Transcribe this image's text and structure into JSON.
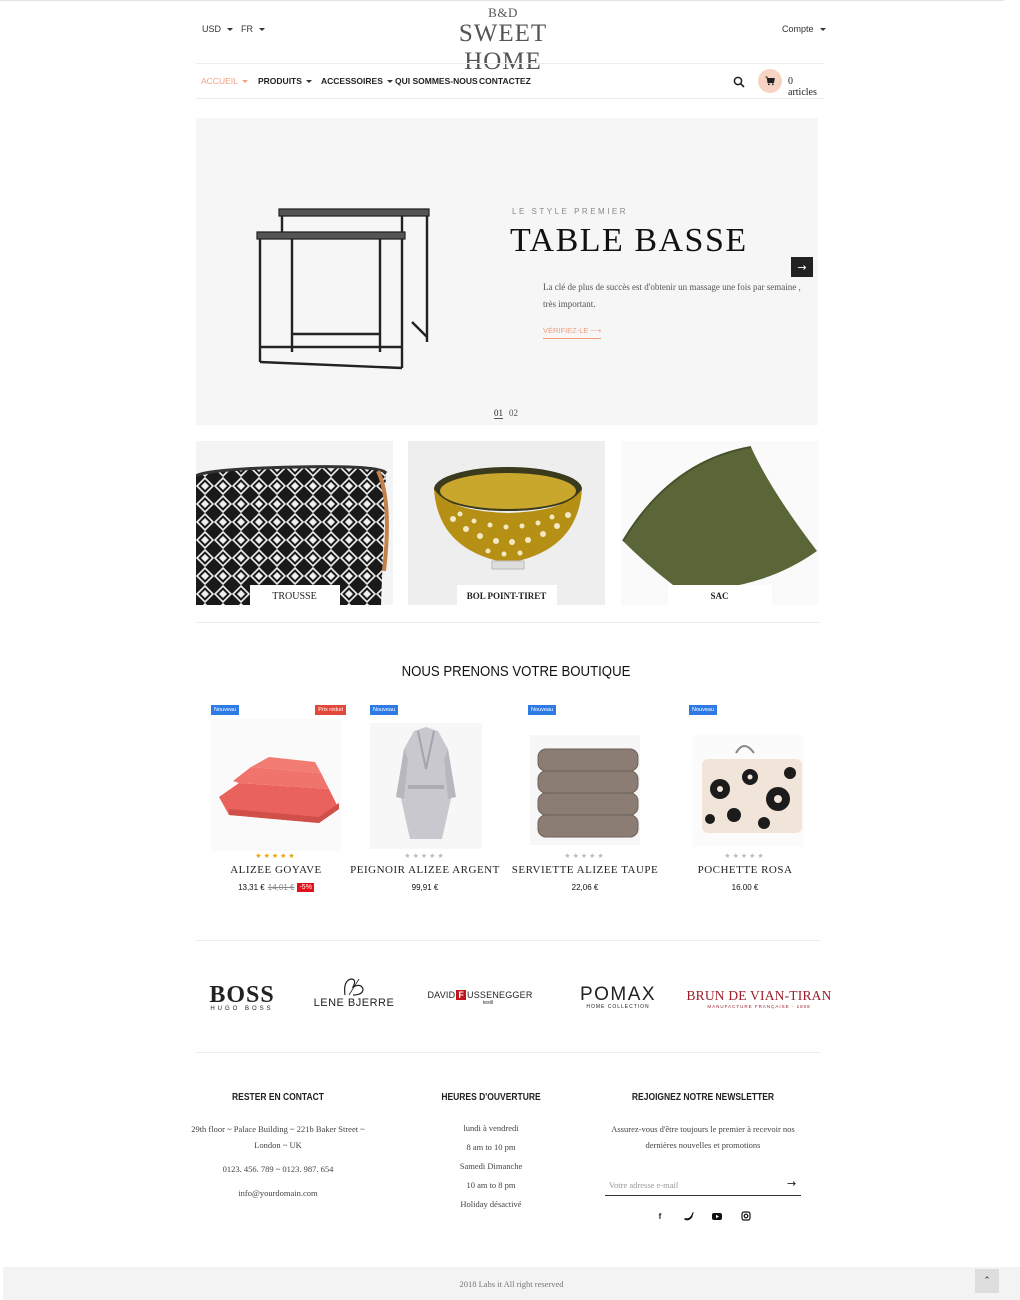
{
  "header": {
    "currency": "USD",
    "language": "FR",
    "logo_top": "B&D",
    "logo_main": "SWEET HOME",
    "account": "Compte"
  },
  "nav": {
    "items": [
      {
        "label": "ACCUEIL",
        "active": true,
        "dropdown": true
      },
      {
        "label": "PRODUITS",
        "active": false,
        "dropdown": true
      },
      {
        "label": "ACCESSOIRES",
        "active": false,
        "dropdown": true
      },
      {
        "label": "QUI SOMMES-NOUS",
        "active": false,
        "dropdown": false
      },
      {
        "label": "CONTACTEZ",
        "active": false,
        "dropdown": false
      }
    ],
    "cart_label": "0 articles",
    "icons": [
      "search-icon",
      "cart-icon"
    ]
  },
  "hero": {
    "subtitle": "LE STYLE PREMIER",
    "title": "TABLE BASSE",
    "description": "La clé de plus de succès est d'obtenir un massage une fois par semaine , très important.",
    "link": "VÉRIFIEZ-LE",
    "pages": [
      "01",
      "02"
    ],
    "current_page": "01"
  },
  "categories": [
    {
      "label": "TROUSSE"
    },
    {
      "label": "BOL POINT-TIRET"
    },
    {
      "label": "SAC"
    }
  ],
  "products_section": {
    "title": "NOUS PRENONS VOTRE BOUTIQUE",
    "products": [
      {
        "name": "ALIZEE GOYAVE",
        "price": "13,31 €",
        "old_price": "14,01 €",
        "discount": "-5%",
        "badge_new": "Nouveau",
        "badge_sale": "Prix réduit",
        "rating": 5
      },
      {
        "name": "PEIGNOIR ALIZEE ARGENT",
        "price": "99,91 €",
        "badge_new": "Nouveau",
        "rating": 0
      },
      {
        "name": "SERVIETTE ALIZEE TAUPE",
        "price": "22,06 €",
        "badge_new": "Nouveau",
        "rating": 0
      },
      {
        "name": "POCHETTE ROSA",
        "price": "16.00 €",
        "badge_new": "Nouveau",
        "rating": 0
      }
    ]
  },
  "brands": {
    "boss": "BOSS",
    "boss_sub": "HUGO BOSS",
    "lene": "LENE BJERRE",
    "david_a": "DAVID",
    "david_b": "F",
    "david_c": "USSENEGGER",
    "david_sub": "textil",
    "pomax": "POMAX",
    "pomax_sub": "HOME COLLECTION",
    "brun": "BRUN DE VIAN-TIRAN",
    "brun_sub": "MANUFACTURE FRANÇAISE · 1808"
  },
  "footer": {
    "contact_title": "RESTER EN CONTACT",
    "address": "29th floor ~ Palace Building ~ 221b Baker Street ~ London ~ UK",
    "phone": "0123. 456. 789 ~ 0123. 987. 654",
    "email": "info@yourdomain.com",
    "hours_title": "HEURES D'OUVERTURE",
    "hours": [
      "lundi à vendredi",
      "8 am to 10 pm",
      "Samedi Dimanche",
      "10 am to 8 pm",
      "Holiday désactivé"
    ],
    "newsletter_title": "REJOIGNEZ NOTRE NEWSLETTER",
    "newsletter_text": "Assurez-vous d'être toujours le premier à recevoir nos dernières nouvelles et promotions",
    "newsletter_placeholder": "Votre adresse e-mail",
    "social": [
      "facebook-icon",
      "twitter-icon",
      "youtube-icon",
      "instagram-icon"
    ],
    "copyright": "2018 Labs it All right reserved"
  },
  "colors": {
    "accent": "#f0a07e",
    "badge_new": "#2e7be5",
    "badge_sale": "#e2493b",
    "discount": "#e2101a"
  }
}
